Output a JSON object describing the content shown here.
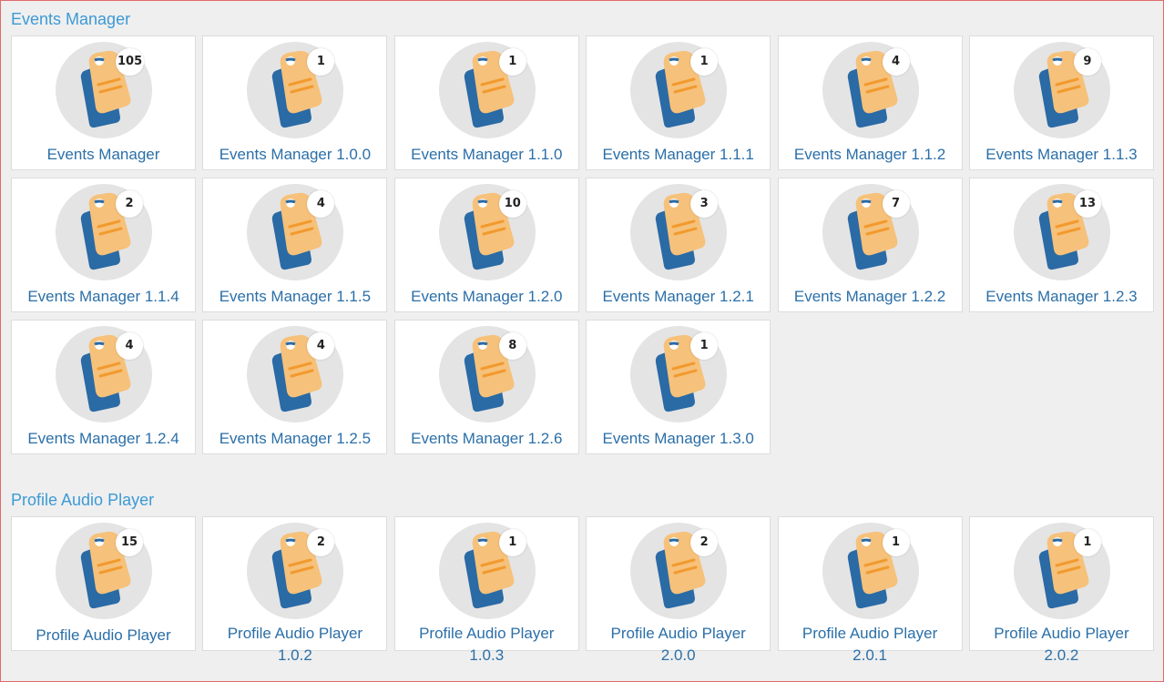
{
  "sections": [
    {
      "title": "Events Manager",
      "tiles": [
        {
          "label": "Events Manager",
          "count": "105"
        },
        {
          "label": "Events Manager 1.0.0",
          "count": "1"
        },
        {
          "label": "Events Manager 1.1.0",
          "count": "1"
        },
        {
          "label": "Events Manager 1.1.1",
          "count": "1"
        },
        {
          "label": "Events Manager 1.1.2",
          "count": "4"
        },
        {
          "label": "Events Manager 1.1.3",
          "count": "9"
        },
        {
          "label": "Events Manager 1.1.4",
          "count": "2"
        },
        {
          "label": "Events Manager 1.1.5",
          "count": "4"
        },
        {
          "label": "Events Manager 1.2.0",
          "count": "10"
        },
        {
          "label": "Events Manager 1.2.1",
          "count": "3"
        },
        {
          "label": "Events Manager 1.2.2",
          "count": "7"
        },
        {
          "label": "Events Manager 1.2.3",
          "count": "13"
        },
        {
          "label": "Events Manager 1.2.4",
          "count": "4"
        },
        {
          "label": "Events Manager 1.2.5",
          "count": "4"
        },
        {
          "label": "Events Manager 1.2.6",
          "count": "8"
        },
        {
          "label": "Events Manager 1.3.0",
          "count": "1"
        }
      ]
    },
    {
      "title": "Profile Audio Player",
      "tiles": [
        {
          "label": "Profile Audio Player",
          "label2": "",
          "count": "15"
        },
        {
          "label": "Profile Audio Player",
          "label2": "1.0.2",
          "count": "2"
        },
        {
          "label": "Profile Audio Player",
          "label2": "1.0.3",
          "count": "1"
        },
        {
          "label": "Profile Audio Player",
          "label2": "2.0.0",
          "count": "2"
        },
        {
          "label": "Profile Audio Player",
          "label2": "2.0.1",
          "count": "1"
        },
        {
          "label": "Profile Audio Player",
          "label2": "2.0.2",
          "count": "1"
        }
      ]
    }
  ],
  "icon": "tag-stack-icon",
  "colors": {
    "title": "#3c9ad6",
    "label": "#2b6fa8",
    "tag_front": "#f6c17a",
    "tag_back": "#2a6aa5",
    "circle": "#e4e4e4",
    "stripe": "#f29a2e"
  }
}
